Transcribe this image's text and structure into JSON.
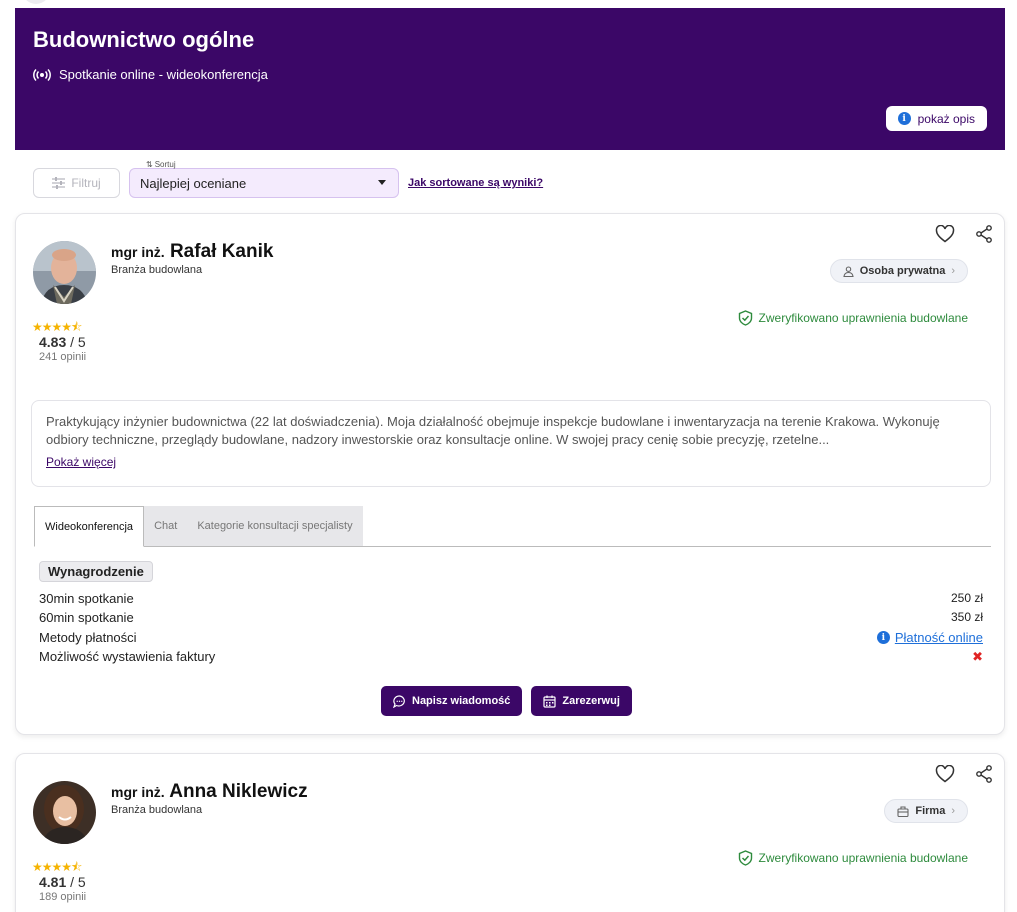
{
  "banner": {
    "title": "Budownictwo ogólne",
    "subtitle": "Spotkanie online - wideokonferencja",
    "description_button": "pokaż opis"
  },
  "toolbar": {
    "filter_label": "Filtruj",
    "sort_label": "Sortuj",
    "sort_value": "Najlepiej oceniane",
    "sort_help": "Jak sortowane są wyniki?"
  },
  "colors": {
    "brand": "#3b0767",
    "verified": "#2e8b3d",
    "link": "#1e6fd9",
    "star": "#f5b301",
    "error": "#e02424"
  },
  "experts": [
    {
      "prefix": "mgr inż.",
      "name": "Rafał Kanik",
      "industry": "Branża budowlana",
      "stars": "★★★★⯪",
      "rating": "4.83",
      "rating_max": "/ 5",
      "reviews": "241 opinii",
      "type": "Osoba prywatna",
      "type_icon": "person-icon",
      "verified": "Zweryfikowano uprawnienia budowlane",
      "bio": "Praktykujący inżynier budownictwa (22 lat doświadczenia). Moja działalność obejmuje inspekcje budowlane i inwentaryzacja na terenie Krakowa. Wykonuję odbiory techniczne, przeglądy budowlane, nadzory inwestorskie oraz konsultacje online. W swojej pracy cenię sobie precyzję, rzetelne...",
      "bio_more": "Pokaż więcej",
      "tabs": [
        "Wideokonferencja",
        "Chat",
        "Kategorie konsultacji specjalisty"
      ],
      "payment_header": "Wynagrodzenie",
      "rows": [
        {
          "label": "30min spotkanie",
          "value": "250 zł"
        },
        {
          "label": "60min spotkanie",
          "value": "350 zł"
        },
        {
          "label": "Metody płatności",
          "value": "Płatność online"
        },
        {
          "label": "Możliwość wystawienia faktury",
          "value": "✖"
        }
      ],
      "message_button": "Napisz wiadomość",
      "book_button": "Zarezerwuj"
    },
    {
      "prefix": "mgr inż.",
      "name": "Anna Niklewicz",
      "industry": "Branża budowlana",
      "stars": "★★★★⯪",
      "rating": "4.81",
      "rating_max": "/ 5",
      "reviews": "189 opinii",
      "type": "Firma",
      "type_icon": "building-icon",
      "verified": "Zweryfikowano uprawnienia budowlane"
    }
  ]
}
